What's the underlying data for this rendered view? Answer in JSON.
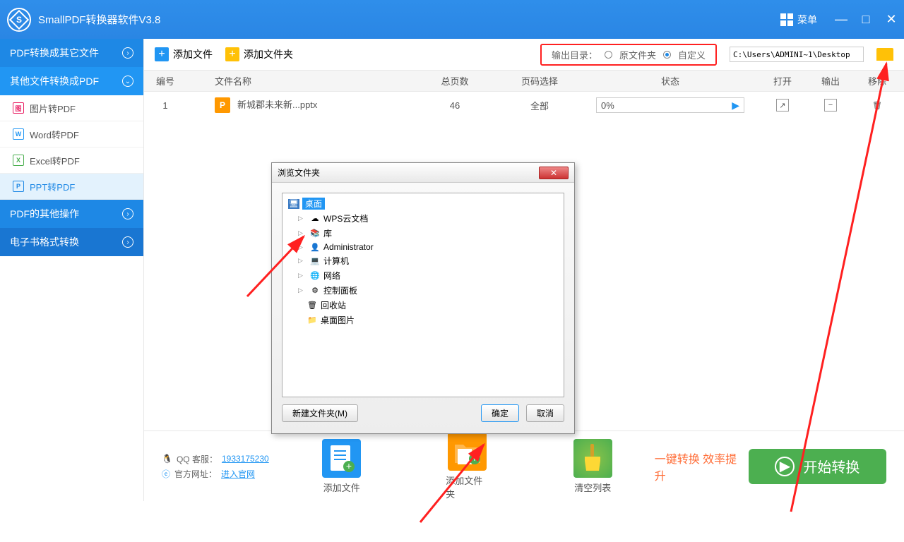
{
  "app": {
    "title": "SmallPDF转换器软件V3.8",
    "menu_label": "菜单"
  },
  "sidebar": {
    "cat1": "PDF转换成其它文件",
    "cat2": "其他文件转换成PDF",
    "subs": [
      "图片转PDF",
      "Word转PDF",
      "Excel转PDF",
      "PPT转PDF"
    ],
    "sub_icons": [
      "图",
      "W",
      "X",
      "P"
    ],
    "cat3": "PDF的其他操作",
    "cat4": "电子书格式转换"
  },
  "toolbar": {
    "add_file": "添加文件",
    "add_folder": "添加文件夹",
    "output_label": "输出目录：",
    "opt_source": "原文件夹",
    "opt_custom": "自定义",
    "path": "C:\\Users\\ADMINI~1\\Desktop"
  },
  "table": {
    "headers": {
      "no": "编号",
      "name": "文件名称",
      "pages": "总页数",
      "sel": "页码选择",
      "status": "状态",
      "open": "打开",
      "out": "输出",
      "del": "移除"
    },
    "rows": [
      {
        "no": "1",
        "badge": "P",
        "name": "新城郡未来新...pptx",
        "pages": "46",
        "sel": "全部",
        "progress": "0%"
      }
    ]
  },
  "dialog": {
    "title": "浏览文件夹",
    "tree": [
      "桌面",
      "WPS云文档",
      "库",
      "Administrator",
      "计算机",
      "网络",
      "控制面板",
      "回收站",
      "桌面图片"
    ],
    "new_folder": "新建文件夹(M)",
    "ok": "确定",
    "cancel": "取消"
  },
  "footer": {
    "qq_label": "QQ 客服：",
    "qq": "1933175230",
    "site_label": "官方网址：",
    "site": "进入官网",
    "add_file": "添加文件",
    "add_folder": "添加文件夹",
    "clear": "清空列表",
    "promo": "一键转换  效率提升",
    "start": "开始转换"
  }
}
